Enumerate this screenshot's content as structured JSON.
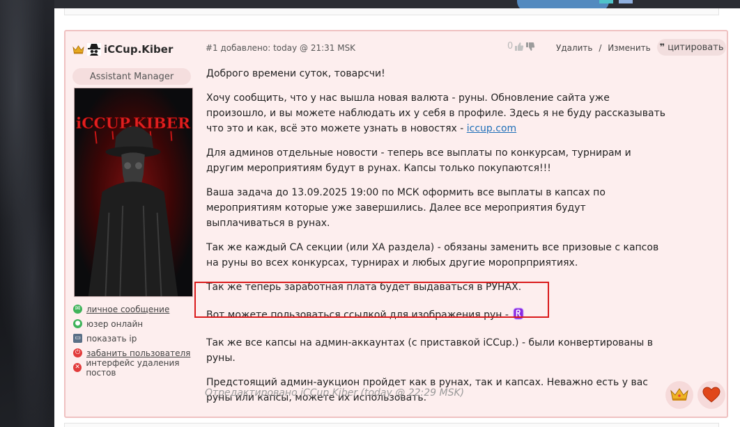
{
  "post": {
    "author": {
      "name": "iCCup.Kiber",
      "role": "Assistant Manager"
    },
    "meta": "#1 добавлено: today @ 21:31 MSK",
    "votes": "0",
    "delete_label": "Удалить",
    "separator": "/",
    "edit_label": "Изменить",
    "quote_label": "цитировать",
    "paragraphs": [
      "Доброго времени суток, товарсчи!",
      "Хочу сообщить, что у нас вышла новая валюта - руны. Обновление сайта уже произошло, и вы можете наблюдать их у себя в профиле. Здесь я не буду рассказывать что это и как, всё это можете узнать в новостях - ",
      "Для админов отдельные новости - теперь все выплаты по конкурсам, турнирам и другим мероприятиям будут в рунах. Капсы только покупаются!!!",
      "Ваша задача до 13.09.2025 19:00 по МСК оформить все выплаты в капсах по мероприятиям которые уже завершились. Далее все мероприятия будут выплачиваться в рунах.",
      "Так же каждый СА секции (или ХА раздела) - обязаны заменить все призовые с капсов на руны во всех конкурсах, турнирах и любых другие моропрприятиях.",
      "Так же теперь заработная плата будет выдаваться в РУНАХ.",
      "Вот можете пользоваться ссылкой для изображения рун - ",
      "Так же все капсы на админ-аккаунтах (с приставкой iCCup.) - были конвертированы в руны.",
      "Предстоящий админ-аукцион пройдет как в рунах, так и капсах. Неважно есть у вас руны или капсы, можете их использовать."
    ],
    "news_link": "iccup.com",
    "edited_note": "Отредактировано iCCup.Kiber (today @ 22:29 MSK)",
    "user_actions": [
      {
        "label": "личное сообщение",
        "icon": "mail-icon",
        "color": "#3fb35a"
      },
      {
        "label": "юзер онлайн",
        "icon": "online-icon",
        "color": "#3fb35a"
      },
      {
        "label": "показать ip",
        "icon": "monitor-icon",
        "color": "#5a6f86"
      },
      {
        "label": "забанить пользователя",
        "icon": "power-icon",
        "color": "#e23b3b"
      },
      {
        "label": "интерфейс удаления постов",
        "icon": "delete-icon",
        "color": "#e23b3b"
      }
    ],
    "avatar_text": "iCCUP.KIBER",
    "reactions": [
      "crown-icon",
      "heart-icon"
    ]
  },
  "colors": {
    "post_bg": "#fdeeee",
    "post_border": "#efc1c1",
    "highlight": "#d9191a",
    "link": "#1f6fb8"
  }
}
